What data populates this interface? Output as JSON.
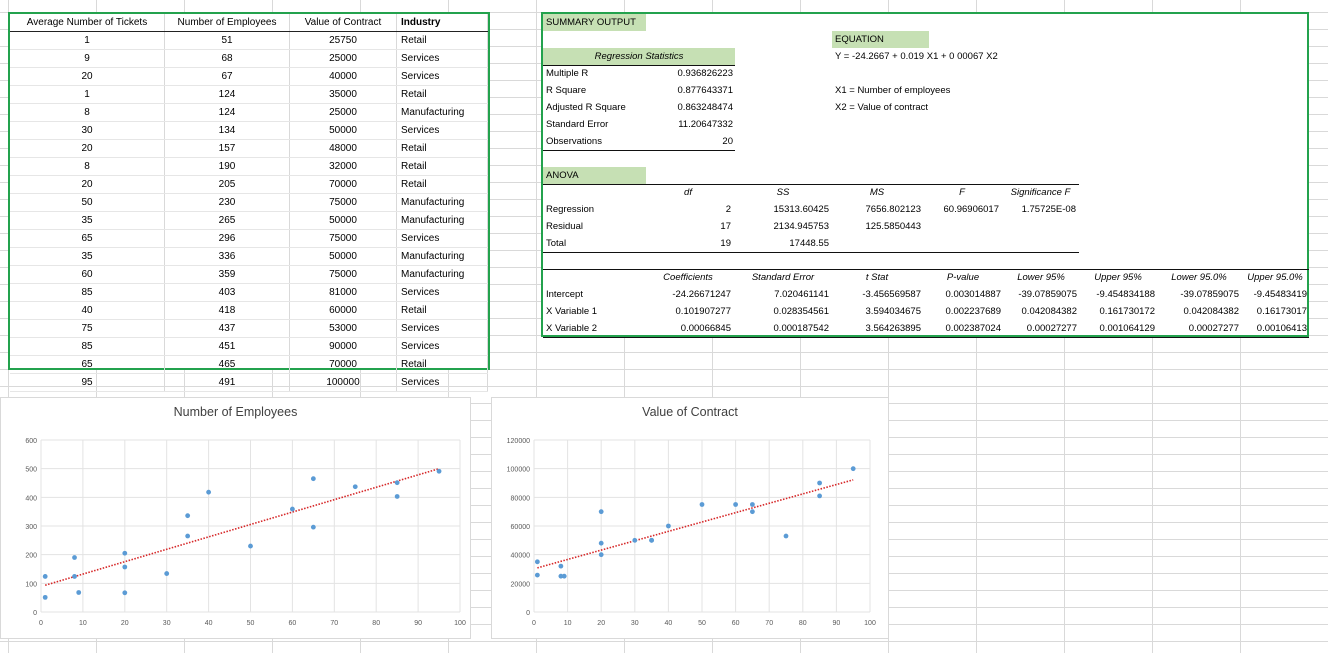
{
  "data_table": {
    "headers": [
      "Average Number of Tickets",
      "Number of Employees",
      "Value of Contract",
      "Industry"
    ],
    "rows": [
      [
        "1",
        "51",
        "25750",
        "Retail"
      ],
      [
        "9",
        "68",
        "25000",
        "Services"
      ],
      [
        "20",
        "67",
        "40000",
        "Services"
      ],
      [
        "1",
        "124",
        "35000",
        "Retail"
      ],
      [
        "8",
        "124",
        "25000",
        "Manufacturing"
      ],
      [
        "30",
        "134",
        "50000",
        "Services"
      ],
      [
        "20",
        "157",
        "48000",
        "Retail"
      ],
      [
        "8",
        "190",
        "32000",
        "Retail"
      ],
      [
        "20",
        "205",
        "70000",
        "Retail"
      ],
      [
        "50",
        "230",
        "75000",
        "Manufacturing"
      ],
      [
        "35",
        "265",
        "50000",
        "Manufacturing"
      ],
      [
        "65",
        "296",
        "75000",
        "Services"
      ],
      [
        "35",
        "336",
        "50000",
        "Manufacturing"
      ],
      [
        "60",
        "359",
        "75000",
        "Manufacturing"
      ],
      [
        "85",
        "403",
        "81000",
        "Services"
      ],
      [
        "40",
        "418",
        "60000",
        "Retail"
      ],
      [
        "75",
        "437",
        "53000",
        "Services"
      ],
      [
        "85",
        "451",
        "90000",
        "Services"
      ],
      [
        "65",
        "465",
        "70000",
        "Retail"
      ],
      [
        "95",
        "491",
        "100000",
        "Services"
      ]
    ]
  },
  "summary": {
    "title": "SUMMARY OUTPUT",
    "regression_stats_header": "Regression Statistics",
    "stats": [
      {
        "label": "Multiple R",
        "value": "0.936826223"
      },
      {
        "label": "R Square",
        "value": "0.877643371"
      },
      {
        "label": "Adjusted R Square",
        "value": "0.863248474"
      },
      {
        "label": "Standard Error",
        "value": "11.20647332"
      },
      {
        "label": "Observations",
        "value": "20"
      }
    ],
    "equation_label": "EQUATION",
    "equation": "Y = -24.2667 + 0.019 X1 + 0 00067 X2",
    "x1_def": "X1 = Number of employees",
    "x2_def": "X2 = Value of contract",
    "anova_label": "ANOVA",
    "anova_headers": [
      "df",
      "SS",
      "MS",
      "F",
      "Significance F"
    ],
    "anova_rows": [
      {
        "label": "Regression",
        "df": "2",
        "ss": "15313.60425",
        "ms": "7656.802123",
        "f": "60.96906017",
        "sig": "1.75725E-08"
      },
      {
        "label": "Residual",
        "df": "17",
        "ss": "2134.945753",
        "ms": "125.5850443",
        "f": "",
        "sig": ""
      },
      {
        "label": "Total",
        "df": "19",
        "ss": "17448.55",
        "ms": "",
        "f": "",
        "sig": ""
      }
    ],
    "coef_headers": [
      "Coefficients",
      "Standard Error",
      "t Stat",
      "P-value",
      "Lower 95%",
      "Upper 95%",
      "Lower 95.0%",
      "Upper 95.0%"
    ],
    "coef_rows": [
      {
        "label": "Intercept",
        "vals": [
          "-24.26671247",
          "7.020461141",
          "-3.456569587",
          "0.003014887",
          "-39.07859075",
          "-9.454834188",
          "-39.07859075",
          "-9.45483419"
        ]
      },
      {
        "label": "X Variable 1",
        "vals": [
          "0.101907277",
          "0.028354561",
          "3.594034675",
          "0.002237689",
          "0.042084382",
          "0.161730172",
          "0.042084382",
          "0.16173017"
        ]
      },
      {
        "label": "X Variable 2",
        "vals": [
          "0.00066845",
          "0.000187542",
          "3.564263895",
          "0.002387024",
          "0.00027277",
          "0.001064129",
          "0.00027277",
          "0.00106413"
        ]
      }
    ]
  },
  "chart_data": [
    {
      "type": "scatter",
      "title": "Number of Employees",
      "xlim": [
        0,
        100
      ],
      "ylim": [
        0,
        600
      ],
      "xticks": [
        "0",
        "10",
        "20",
        "30",
        "40",
        "50",
        "60",
        "70",
        "80",
        "90",
        "100"
      ],
      "yticks": [
        "0",
        "100",
        "200",
        "300",
        "400",
        "500",
        "600"
      ],
      "grid": true,
      "trendline": true,
      "trend_color": "#d62728",
      "point_color": "#5b9bd5",
      "points": [
        [
          1,
          51
        ],
        [
          9,
          68
        ],
        [
          20,
          67
        ],
        [
          1,
          124
        ],
        [
          8,
          124
        ],
        [
          30,
          134
        ],
        [
          20,
          157
        ],
        [
          8,
          190
        ],
        [
          20,
          205
        ],
        [
          50,
          230
        ],
        [
          35,
          265
        ],
        [
          65,
          296
        ],
        [
          35,
          336
        ],
        [
          60,
          359
        ],
        [
          85,
          403
        ],
        [
          40,
          418
        ],
        [
          75,
          437
        ],
        [
          85,
          451
        ],
        [
          65,
          465
        ],
        [
          95,
          491
        ]
      ]
    },
    {
      "type": "scatter",
      "title": "Value of Contract",
      "xlim": [
        0,
        100
      ],
      "ylim": [
        0,
        120000
      ],
      "xticks": [
        "0",
        "10",
        "20",
        "30",
        "40",
        "50",
        "60",
        "70",
        "80",
        "90",
        "100"
      ],
      "yticks": [
        "0",
        "20000",
        "40000",
        "60000",
        "80000",
        "100000",
        "120000"
      ],
      "grid": true,
      "trendline": true,
      "trend_color": "#d62728",
      "point_color": "#5b9bd5",
      "points": [
        [
          1,
          25750
        ],
        [
          9,
          25000
        ],
        [
          20,
          40000
        ],
        [
          1,
          35000
        ],
        [
          8,
          25000
        ],
        [
          30,
          50000
        ],
        [
          20,
          48000
        ],
        [
          8,
          32000
        ],
        [
          20,
          70000
        ],
        [
          50,
          75000
        ],
        [
          35,
          50000
        ],
        [
          65,
          75000
        ],
        [
          35,
          50000
        ],
        [
          60,
          75000
        ],
        [
          85,
          81000
        ],
        [
          40,
          60000
        ],
        [
          75,
          53000
        ],
        [
          85,
          90000
        ],
        [
          65,
          70000
        ],
        [
          95,
          100000
        ]
      ]
    }
  ]
}
